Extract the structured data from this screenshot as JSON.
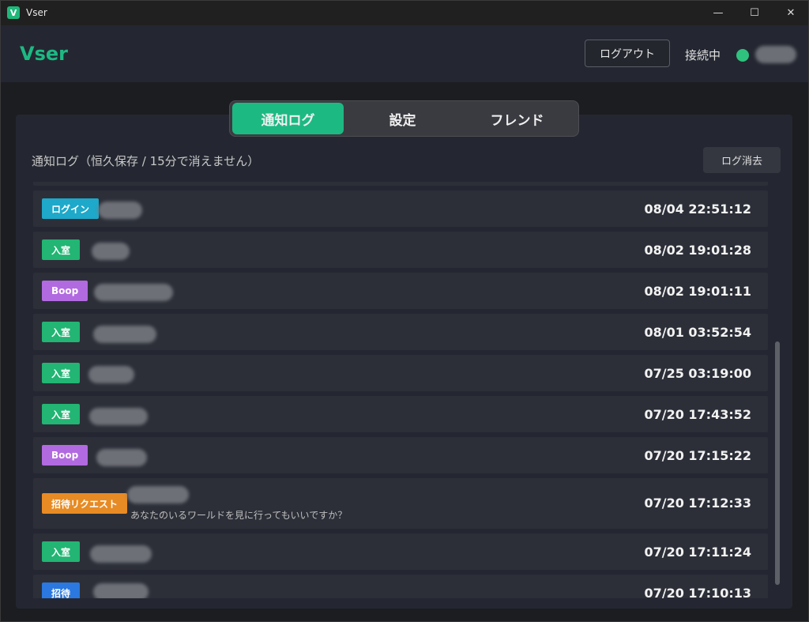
{
  "window": {
    "title": "Vser",
    "minimize": "—",
    "maximize": "☐",
    "close": "✕"
  },
  "header": {
    "logo": "Vser",
    "logout_label": "ログアウト",
    "status_label": "接続中",
    "status_color": "#2ec27e"
  },
  "tabs": [
    {
      "label": "通知ログ",
      "active": true
    },
    {
      "label": "設定",
      "active": false
    },
    {
      "label": "フレンド",
      "active": false
    }
  ],
  "log": {
    "title": "通知ログ（恒久保存 / 15分で消えません）",
    "clear_label": "ログ消去",
    "badge_colors": {
      "ログイン": "#1ea8c9",
      "入室": "#22b573",
      "Boop": "#b26ae0",
      "招待リクエスト": "#e78b24",
      "招待": "#2a78e0"
    },
    "entries": [
      {
        "type": "ログイン",
        "time": "08/04 22:51:12",
        "message": ""
      },
      {
        "type": "入室",
        "time": "08/02 19:01:28",
        "message": ""
      },
      {
        "type": "Boop",
        "time": "08/02 19:01:11",
        "message": ""
      },
      {
        "type": "入室",
        "time": "08/01 03:52:54",
        "message": ""
      },
      {
        "type": "入室",
        "time": "07/25 03:19:00",
        "message": ""
      },
      {
        "type": "入室",
        "time": "07/20 17:43:52",
        "message": ""
      },
      {
        "type": "Boop",
        "time": "07/20 17:15:22",
        "message": ""
      },
      {
        "type": "招待リクエスト",
        "time": "07/20 17:12:33",
        "message": "あなたのいるワールドを見に行ってもいいですか？"
      },
      {
        "type": "入室",
        "time": "07/20 17:11:24",
        "message": ""
      },
      {
        "type": "招待",
        "time": "07/20 17:10:13",
        "message": ""
      }
    ]
  }
}
